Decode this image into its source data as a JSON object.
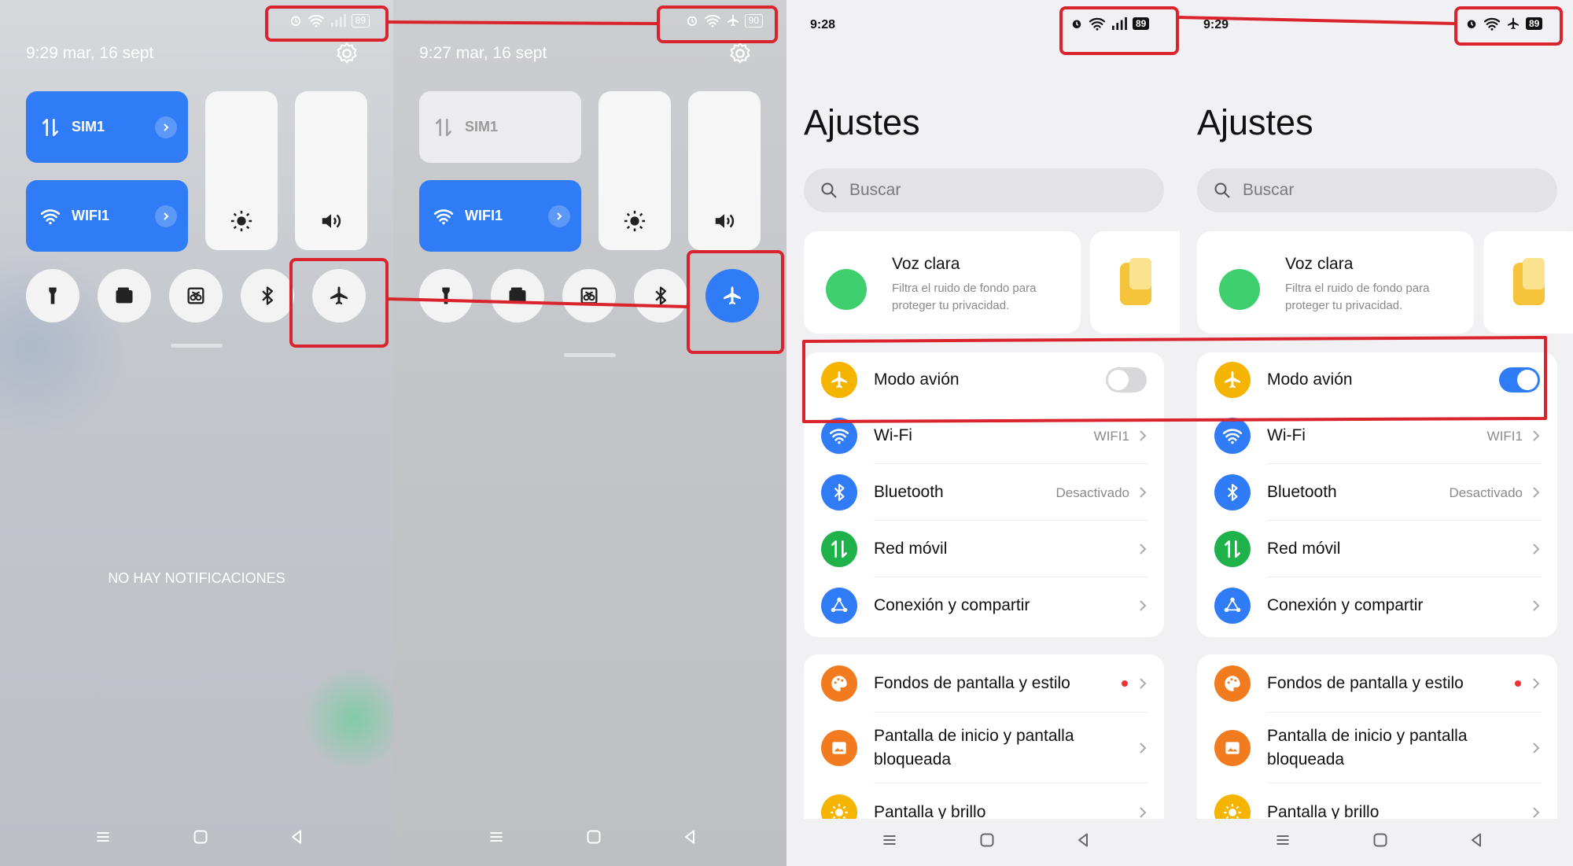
{
  "control_center_before": {
    "time": "9:29",
    "date": "mar, 16 sept",
    "battery": "89",
    "sim_tile": "SIM1",
    "wifi_tile": "WIFI1",
    "notifications_empty": "NO HAY NOTIFICACIONES"
  },
  "control_center_after": {
    "time": "9:27",
    "date": "mar, 16 sept",
    "battery": "90",
    "sim_tile": "SIM1",
    "wifi_tile": "WIFI1"
  },
  "settings_before": {
    "time": "9:28",
    "battery": "89",
    "airplane_mode": false
  },
  "settings_after": {
    "time": "9:29",
    "battery": "89",
    "airplane_mode": true
  },
  "settings": {
    "title": "Ajustes",
    "search_placeholder": "Buscar",
    "promo_title": "Voz clara",
    "promo_subtitle": "Filtra el ruido de fondo para proteger tu privacidad.",
    "items": [
      {
        "label": "Modo avión",
        "value": ""
      },
      {
        "label": "Wi-Fi",
        "value": "WIFI1"
      },
      {
        "label": "Bluetooth",
        "value": "Desactivado"
      },
      {
        "label": "Red móvil",
        "value": ""
      },
      {
        "label": "Conexión y compartir",
        "value": ""
      },
      {
        "label": "Fondos de pantalla y estilo",
        "value": ""
      },
      {
        "label": "Pantalla de inicio y pantalla bloqueada",
        "value": ""
      },
      {
        "label": "Pantalla y brillo",
        "value": ""
      }
    ]
  },
  "colors": {
    "accent": "#2f7cf6",
    "annotation": "#d9232d",
    "airplane_icon": "#f5b400",
    "mobile_icon": "#1fb24a",
    "theme_icon": "#f27b1f"
  },
  "icons": [
    "alarm-icon",
    "wifi-icon",
    "signal-icon",
    "airplane-icon",
    "gear-icon",
    "sun-icon",
    "volume-icon",
    "flashlight-icon",
    "wallet-icon",
    "screenshot-icon",
    "bluetooth-icon",
    "search-icon",
    "chevron-right-icon",
    "mobile-data-icon",
    "share-icon",
    "palette-icon",
    "image-icon"
  ]
}
